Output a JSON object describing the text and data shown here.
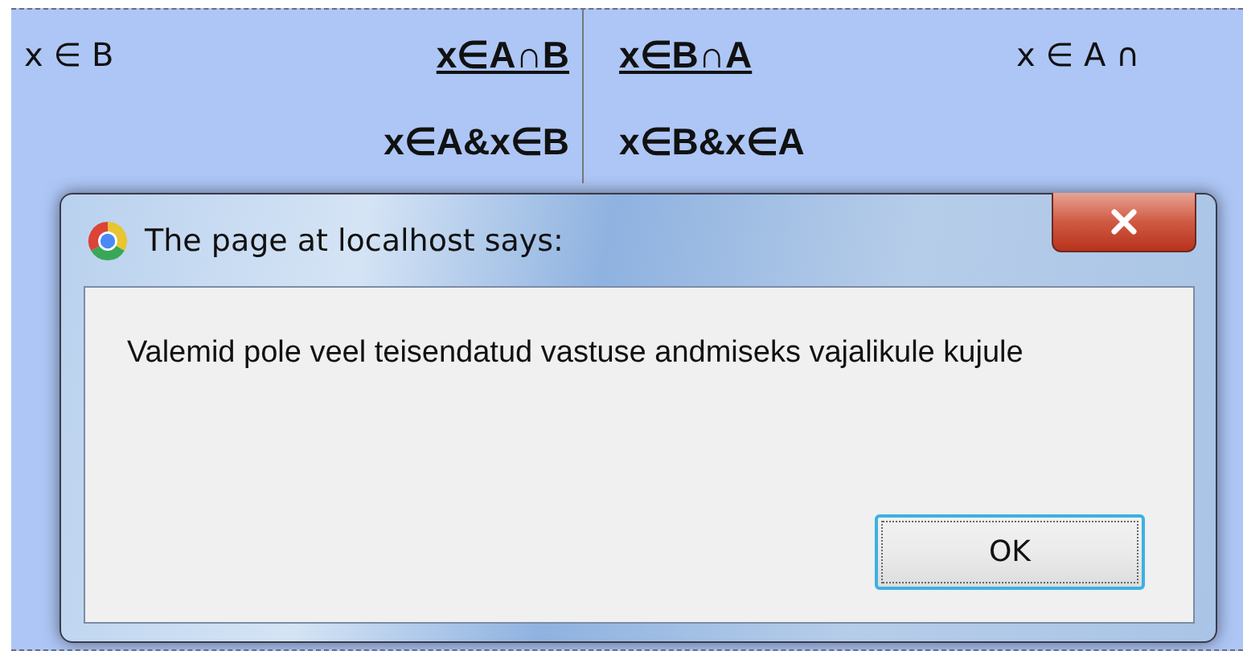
{
  "table": {
    "rows": [
      {
        "column_1": {
          "text": "x ∈ B",
          "bold": false,
          "underline": false
        },
        "column_2": {
          "text": "x∈A∩B",
          "bold": true,
          "underline": true
        },
        "column_3": {
          "text": "x∈B∩A",
          "bold": true,
          "underline": true
        },
        "column_4": {
          "text": "x ∈ A ∩",
          "bold": false,
          "underline": false
        }
      },
      {
        "column_2": {
          "text": "x∈A&x∈B",
          "bold": true,
          "underline": false
        },
        "column_3": {
          "text": "x∈B&x∈A",
          "bold": true,
          "underline": false
        }
      }
    ]
  },
  "dialog": {
    "title": "The page at localhost says:",
    "message": "Valemid pole veel teisendatud vastuse andmiseks vajalikule kujule",
    "buttons": [
      {
        "label": "OK",
        "focused": true
      }
    ]
  }
}
